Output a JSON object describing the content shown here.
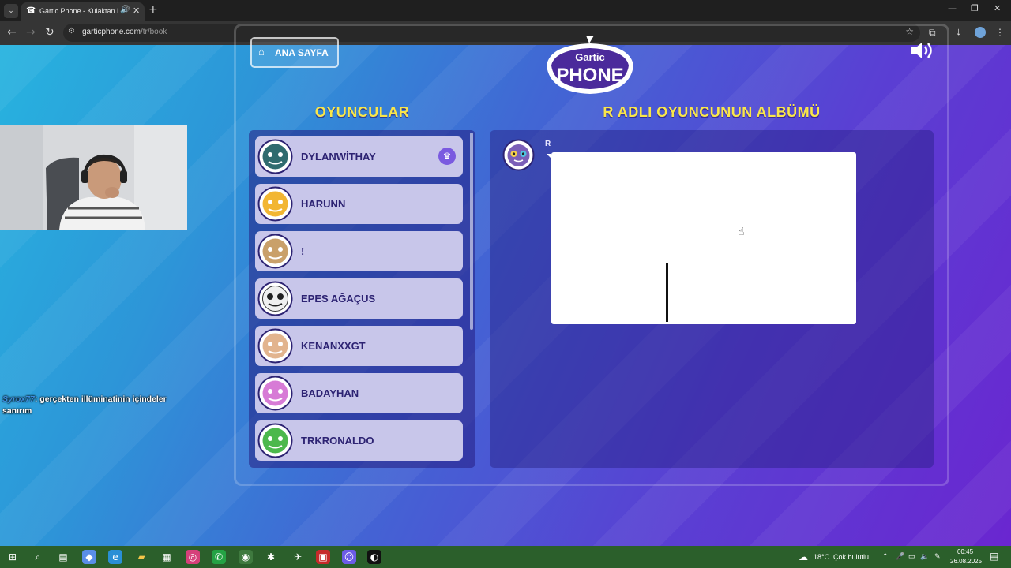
{
  "browser": {
    "tab_title": "Gartic Phone - Kulaktan Kula",
    "url_host": "garticphone.com",
    "url_path": "/tr/book"
  },
  "game": {
    "home_button": "ANA SAYFA",
    "logo_top": "Gartic",
    "logo_bottom": "PHONE",
    "players_heading": "OYUNCULAR",
    "album_heading": "R ADLI OYUNCUNUN ALBÜMÜ",
    "players": [
      {
        "name": "DYLANWİTHAY",
        "host": true,
        "color": "#2f6b6f"
      },
      {
        "name": "HARUNN",
        "color": "#f2b632"
      },
      {
        "name": "!",
        "color": "#c9a06a"
      },
      {
        "name": "EPES AĞAÇUS",
        "color": "#f0f0f0"
      },
      {
        "name": "KENANXXGT",
        "color": "#e2b48e"
      },
      {
        "name": "BADAYHAN",
        "color": "#d77bd6"
      },
      {
        "name": "TRKRONALDO",
        "color": "#4cb84c"
      }
    ],
    "album_author": "R"
  },
  "chat": {
    "user": "Syrox77",
    "message": ": gerçekten illüminatinin içindeler sanırım"
  },
  "taskbar": {
    "weather_temp": "18°C",
    "weather_desc": "Çok bulutlu",
    "time": "00:45",
    "date": "26.08.2025"
  },
  "colors": {
    "heading": "#f9e64a",
    "player_card": "#c8c6ea",
    "player_name": "#2d2373"
  }
}
